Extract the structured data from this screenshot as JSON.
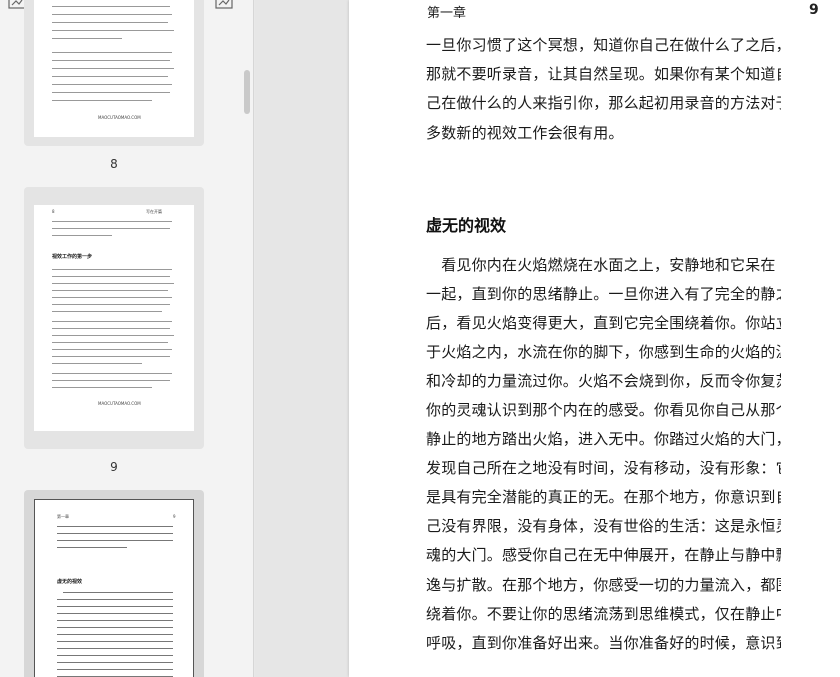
{
  "sidebar": {
    "thumbnails": [
      {
        "number": "8",
        "footer": "MAOCUTAOMAO.COM"
      },
      {
        "number": "9",
        "header_left": "8",
        "header_right": "写在开篇",
        "section": "视效工作的第一步",
        "footer": "MAOCUTAOMAO.COM"
      },
      {
        "number": "",
        "header_left": "第一章",
        "header_right": "9",
        "section": "虚无的视效"
      }
    ]
  },
  "page": {
    "header": "第一章",
    "number": "9",
    "paragraph1": [
      "一旦你习惯了这个冥想，知道你自己在做什么了之后，",
      "那就不要听录音，让其自然呈现。如果你有某个知道自",
      "己在做什么的人来指引你，那么起初用录音的方法对于",
      "多数新的视效工作会很有用。"
    ],
    "section_title": "虚无的视效",
    "paragraph2": [
      "　看见你内在火焰燃烧在水面之上，安静地和它呆在",
      "一起，直到你的思绪静止。一旦你进入有了完全的静之",
      "后，看见火焰变得更大，直到它完全围绕着你。你站立",
      "于火焰之内，水流在你的脚下，你感到生命的火焰的温",
      "和冷却的力量流过你。火焰不会烧到你，反而令你复苏，",
      "你的灵魂认识到那个内在的感受。你看见你自己从那个",
      "静止的地方踏出火焰，进入无中。你踏过火焰的大门，",
      "发现自己所在之地没有时间，没有移动，没有形象：它",
      "是具有完全潜能的真正的无。在那个地方，你意识到自",
      "己没有界限，没有身体，没有世俗的生活：这是永恒灵",
      "魂的大门。感受你自己在无中伸展开，在静止与静中飘",
      "逸与扩散。在那个地方，你感受一切的力量流入，都围",
      "绕着你。不要让你的思绪流荡到思维模式，仅在静止中",
      "呼吸，直到你准备好出来。当你准备好的时候，意识到"
    ]
  }
}
